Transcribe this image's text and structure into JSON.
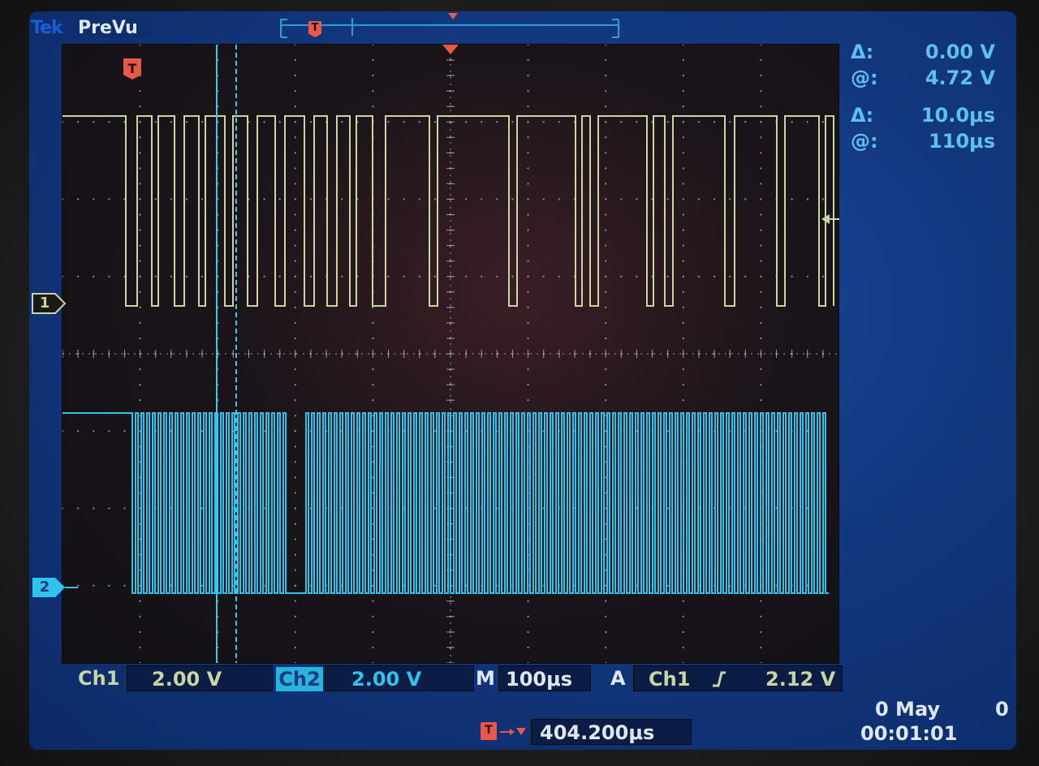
{
  "header": {
    "brand": "Tek",
    "mode": "PreVu",
    "record_trigger_marker": "T"
  },
  "cursor_readout": {
    "voltage": {
      "delta_symbol": "Δ:",
      "delta_value": "0.00 V",
      "at_symbol": "@:",
      "at_value": "4.72 V"
    },
    "time": {
      "delta_symbol": "Δ:",
      "delta_value": "10.0μs",
      "at_symbol": "@:",
      "at_value": "110μs"
    }
  },
  "waveform_markers": {
    "trigger_marker": "T",
    "ch1_marker": "1",
    "ch2_marker": "2"
  },
  "bottom_bar": {
    "ch1_label": "Ch1",
    "ch1_scale": "2.00 V",
    "ch2_label": "Ch2",
    "ch2_scale": "2.00 V",
    "timebase_label": "M",
    "timebase_value": "100μs",
    "trigger_mode": "A",
    "trigger_source": "Ch1",
    "trigger_slope_icon": "rising-edge-icon",
    "trigger_level": "2.12 V",
    "trigger_position_marker": "T",
    "trigger_position_value": "404.200μs",
    "date": "0 May",
    "date_extra": "0",
    "time": "00:01:01"
  },
  "colors": {
    "ch1": "#c9d6a4",
    "ch2": "#2fc3ee",
    "cursor": "#3ec6f2",
    "trigger": "#e8594a",
    "readout": "#5ec0ee",
    "screen_bg": "#12387f"
  }
}
